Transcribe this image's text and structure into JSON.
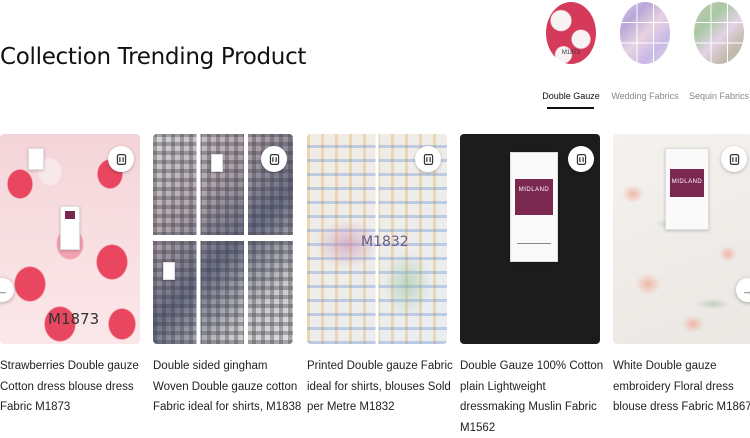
{
  "section": {
    "title": "Collection Trending Product"
  },
  "categories": [
    {
      "label": "Double Gauze",
      "code": "M1873",
      "active": true
    },
    {
      "label": "Wedding Fabrics",
      "active": false
    },
    {
      "label": "Sequin Fabrics",
      "active": false
    }
  ],
  "products": [
    {
      "title": "Strawberries Double gauze Cotton dress blouse dress Fabric M1873",
      "overlay_code": "M1873",
      "compare_icon": "compare-icon"
    },
    {
      "title": "Double sided gingham Woven Double gauze cotton Fabric ideal for shirts, M1838",
      "compare_icon": "compare-icon"
    },
    {
      "title": "Printed Double gauze Fabric ideal for shirts, blouses Sold per Metre M1832",
      "overlay_code": "M1832",
      "compare_icon": "compare-icon"
    },
    {
      "title": "Double Gauze 100% Cotton plain Lightweight dressmaking Muslin Fabric M1562",
      "tag_brand": "MIDLAND",
      "compare_icon": "compare-icon"
    },
    {
      "title": "White Double gauze embroidery Floral dress blouse dress Fabric M1867",
      "tag_brand": "MIDLAND",
      "compare_icon": "compare-icon"
    }
  ],
  "navigation": {
    "prev_icon": "arrow-left-icon",
    "next_icon": "arrow-right-icon"
  }
}
